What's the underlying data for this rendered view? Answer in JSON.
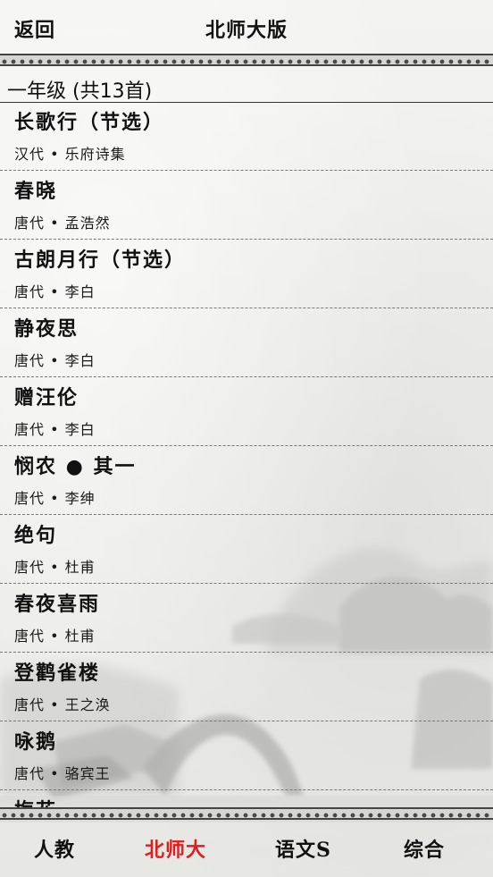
{
  "header": {
    "back_label": "返回",
    "title": "北师大版"
  },
  "grade": {
    "label": "一年级 (共13首)"
  },
  "poems": [
    {
      "title": "长歌行（节选）",
      "subtitle": "汉代 • 乐府诗集"
    },
    {
      "title": "春晓",
      "subtitle": "唐代 • 孟浩然"
    },
    {
      "title": "古朗月行（节选）",
      "subtitle": "唐代 • 李白"
    },
    {
      "title": "静夜思",
      "subtitle": "唐代 • 李白"
    },
    {
      "title": "赠汪伦",
      "subtitle": "唐代 • 李白"
    },
    {
      "title": "悯农 ● 其一",
      "subtitle": "唐代 • 李绅"
    },
    {
      "title": "绝句",
      "subtitle": "唐代 • 杜甫"
    },
    {
      "title": "春夜喜雨",
      "subtitle": "唐代 • 杜甫"
    },
    {
      "title": "登鹳雀楼",
      "subtitle": "唐代 • 王之涣"
    },
    {
      "title": "咏鹅",
      "subtitle": "唐代 • 骆宾王"
    },
    {
      "title": "梅花",
      "subtitle": ""
    }
  ],
  "tabs": [
    {
      "label": "人教",
      "active": false
    },
    {
      "label": "北师大",
      "active": true
    },
    {
      "label": "语文S",
      "active": false
    },
    {
      "label": "综合",
      "active": false
    }
  ],
  "colors": {
    "active_tab": "#e21b1b",
    "ink": "#111111",
    "paper": "#efefec"
  }
}
